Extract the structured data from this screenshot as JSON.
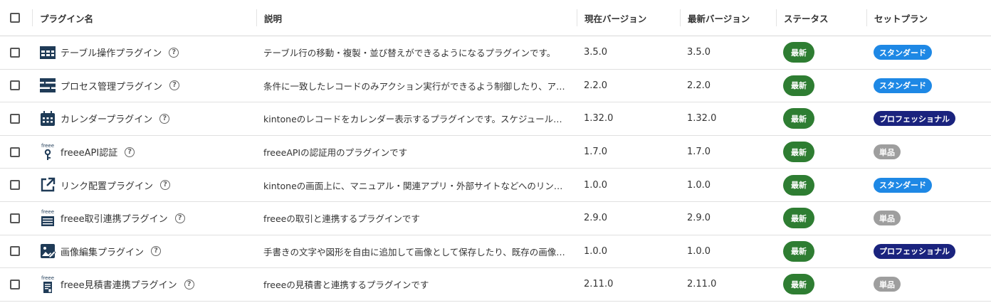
{
  "table": {
    "headers": {
      "name": "プラグイン名",
      "description": "説明",
      "current_version": "現在バージョン",
      "latest_version": "最新バージョン",
      "status": "ステータス",
      "plan": "セットプラン"
    },
    "help_glyph": "?",
    "rows": [
      {
        "icon": "table-icon",
        "name": "テーブル操作プラグイン",
        "description": "テーブル行の移動・複製・並び替えができるようになるプラグインです。",
        "current": "3.5.0",
        "latest": "3.5.0",
        "status": "最新",
        "plan": "スタンダード"
      },
      {
        "icon": "process-icon",
        "name": "プロセス管理プラグイン",
        "description": "条件に一致したレコードのみアクション実行ができるよう制御したり、ア…",
        "current": "2.2.0",
        "latest": "2.2.0",
        "status": "最新",
        "plan": "スタンダード"
      },
      {
        "icon": "calendar-icon",
        "name": "カレンダープラグイン",
        "description": "kintoneのレコードをカレンダー表示するプラグインです。スケジュール…",
        "current": "1.32.0",
        "latest": "1.32.0",
        "status": "最新",
        "plan": "プロフェッショナル"
      },
      {
        "icon": "freee-key-icon",
        "name": "freeeAPI認証",
        "description": "freeeAPIの認証用のプラグインです",
        "current": "1.7.0",
        "latest": "1.7.0",
        "status": "最新",
        "plan": "単品"
      },
      {
        "icon": "external-link-icon",
        "name": "リンク配置プラグイン",
        "description": "kintoneの画面上に、マニュアル・関連アプリ・外部サイトなどへのリン…",
        "current": "1.0.0",
        "latest": "1.0.0",
        "status": "最新",
        "plan": "スタンダード"
      },
      {
        "icon": "freee-transaction-icon",
        "name": "freee取引連携プラグイン",
        "description": "freeeの取引と連携するプラグインです",
        "current": "2.9.0",
        "latest": "2.9.0",
        "status": "最新",
        "plan": "単品"
      },
      {
        "icon": "image-edit-icon",
        "name": "画像編集プラグイン",
        "description": "手書きの文字や図形を自由に追加して画像として保存したり、既存の画像…",
        "current": "1.0.0",
        "latest": "1.0.0",
        "status": "最新",
        "plan": "プロフェッショナル"
      },
      {
        "icon": "freee-quote-icon",
        "name": "freee見積書連携プラグイン",
        "description": "freeeの見積書と連携するプラグインです",
        "current": "2.11.0",
        "latest": "2.11.0",
        "status": "最新",
        "plan": "単品"
      }
    ]
  },
  "icon_label": "freee",
  "colors": {
    "status_latest": "#2e7d32",
    "plan_standard": "#1e88e5",
    "plan_professional": "#1a237e",
    "plan_single": "#9e9e9e",
    "icon": "#1f3b57"
  }
}
